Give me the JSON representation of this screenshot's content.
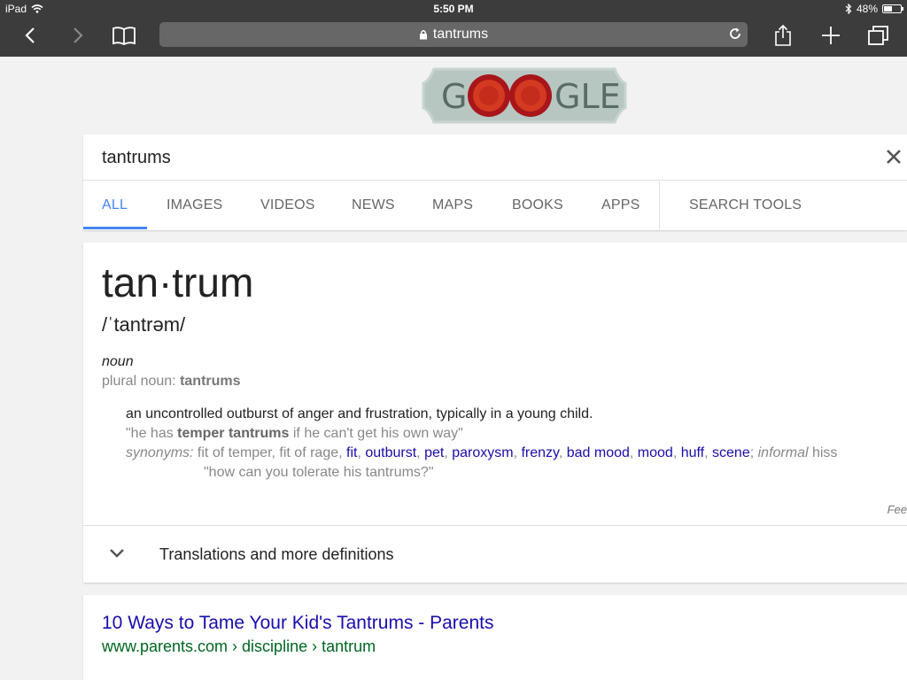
{
  "status_bar": {
    "device": "iPad",
    "time": "5:50 PM",
    "battery_text": "48%",
    "battery_level": 0.48
  },
  "toolbar": {
    "url": "tantrums"
  },
  "search": {
    "query": "tantrums",
    "tabs": [
      "ALL",
      "IMAGES",
      "VIDEOS",
      "NEWS",
      "MAPS",
      "BOOKS",
      "APPS"
    ],
    "tools_label": "SEARCH TOOLS",
    "active_tab": "ALL",
    "accent_color": "#4285f4"
  },
  "logo": {
    "text_left": "G",
    "text_right": "GLE"
  },
  "definition": {
    "word": "tan·trum",
    "phonetic": "/ˈtantrəm/",
    "part_of_speech": "noun",
    "plural_label": "plural noun:",
    "plural_value": "tantrums",
    "meaning": "an uncontrolled outburst of anger and frustration, typically in a young child.",
    "example_pre": "\"he has ",
    "example_bold": "temper tantrums",
    "example_post": " if he can't get his own way\"",
    "synonyms_label": "synonyms:",
    "synonyms_plain": "fit of temper, fit of rage,",
    "synonyms_links": [
      "fit",
      "outburst",
      "pet",
      "paroxysm",
      "frenzy",
      "bad mood",
      "mood",
      "huff",
      "scene"
    ],
    "synonyms_informal_label": "informal",
    "synonyms_informal_value": "hiss",
    "synonym_example": "\"how can you tolerate his tantrums?\"",
    "feedback_label": "Fee",
    "more_label": "Translations and more definitions"
  },
  "result": {
    "title": "10 Ways to Tame Your Kid's Tantrums - Parents",
    "url": "www.parents.com › discipline › tantrum"
  }
}
